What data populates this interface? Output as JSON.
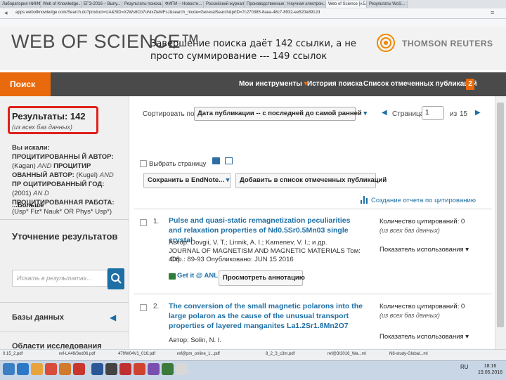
{
  "browser": {
    "tabs": [
      "Лаборатория НИИФ...",
      "Web of Knowledge...",
      "ЕГЭ-2016 – Выпу...",
      "Результаты поиска...",
      "ФИПИ – Новости...",
      "Российский журнал...",
      "Производственные...",
      "Научная электрон...",
      "Web of Science [v.5.2]",
      "Результаты WoS..."
    ],
    "url": "apps.webofknowledge.com/Search.do?product=UA&SID=X2Ws6Cb7uNixZieMFsJ&search_mode=GeneralSearch&prID=7c270385-8aea-48c7-8932-ee520e8912d"
  },
  "header": {
    "logo": "WEB OF SCIENCE™",
    "caption": "Завершение поиска даёт 142 ссылки, а не просто суммирование --- 149 ссылок",
    "partner": "THOMSON REUTERS"
  },
  "nav": {
    "search": "Поиск",
    "my_tools": "Мои инструменты",
    "history": "История поиска",
    "marked": "Список отмеченных публикаций",
    "marked_count": "2"
  },
  "sidebar": {
    "results_title": "Результаты: 142",
    "results_sub": "(из всех баз данных)",
    "query_parts": [
      {
        "t": "Вы искали: ПРОЦИТИРОВАННЫ Й АВТОР: ",
        "s": "b"
      },
      {
        "t": "(Kagan) ",
        "s": "n"
      },
      {
        "t": "AND ",
        "s": "i"
      },
      {
        "t": "ПРОЦИТИР ОВАННЫЙ АВТОР: ",
        "s": "b"
      },
      {
        "t": "(Kugel) ",
        "s": "n"
      },
      {
        "t": "AND ",
        "s": "i"
      },
      {
        "t": "ПР ОЦИТИРОВАННЫЙ ГОД: ",
        "s": "b"
      },
      {
        "t": "(2001) ",
        "s": "n"
      },
      {
        "t": "AN D ",
        "s": "i"
      },
      {
        "t": "ПРОЦИТИРОВАННАЯ РАБОТА: ",
        "s": "b"
      },
      {
        "t": "(Usp* Fiz* Nauk* OR Phys* Usp*)",
        "s": "n"
      }
    ],
    "more": "...Больше",
    "refine_title": "Уточнение результатов",
    "refine_placeholder": "Искать в результатах...",
    "databases": "Базы данных",
    "categories": "Области исследования"
  },
  "toolbar": {
    "sort_label": "Сортировать по:",
    "sort_value": "Дата публикации -- с последней до самой ранней",
    "page_label": "Страница",
    "page_value": "1",
    "page_of": "из",
    "page_total": "15",
    "select_page": "Выбрать страницу",
    "save_endnote": "Сохранить в EndNote...",
    "add_marked": "Добавить в список отмеченных публикаций",
    "citation_report": "Создание отчета по цитированию"
  },
  "records": [
    {
      "num": "1.",
      "title": "Pulse and quasi-static remagnetization peculiarities and relaxation properties of Nd0.5Sr0.5Mn03 single crystal",
      "authors": "Автор: Dovgii, V. T.; Linnik, A. I.; Kamenev, V. I.; и др.",
      "journal": "JOURNAL OF MAGNETISM AND MAGNETIC MATERIALS  Том: 408",
      "pages": "Стр.: 89-93   Опубликовано: JUN 15 2016",
      "cites_label": "Количество цитирований: 0",
      "cites_sub": "(из всех баз данных)",
      "usage": "Показатель использования ▾",
      "getit": "Get it @ ANL",
      "abstract_btn": "Просмотреть аннотацию"
    },
    {
      "num": "2.",
      "title": "The conversion of the small magnetic polarons into the large polaron as the cause of the unusual transport properties of layered manganites La1.2Sr1.8Mn2O7",
      "authors": "Автор: Solin, N. I.",
      "cites_label": "Количество цитирований: 0",
      "cites_sub": "(из всех баз данных)",
      "usage": "Показатель использования ▾"
    }
  ],
  "downloads": [
    "0.15_2.pdf",
    "ref-LA49/3ed06.pdf",
    "479W04V1_016.pdf",
    "ref@pm_online_1...pdf",
    "8_2_3_c3m.pdf",
    "ref@3/2016_Wa...ml",
    "N8-study-Global...ml"
  ],
  "tray": {
    "lang": "RU",
    "time": "18:16",
    "date": "19.05.2016"
  }
}
